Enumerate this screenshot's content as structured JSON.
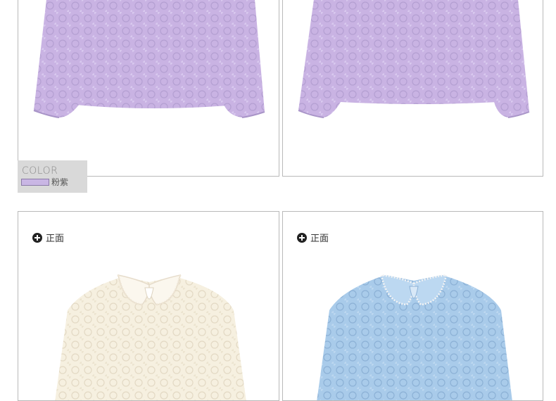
{
  "colors": {
    "lilac": "#c9b3e3",
    "lilac_shadow": "#a995c8",
    "cream": "#f6f0e0",
    "cream_shadow": "#e3d9c4",
    "blue": "#a9cbea",
    "blue_shadow": "#8cb1d6",
    "border": "#b9b9b9",
    "swatch_bg": "#d9d9d9"
  },
  "swatch": {
    "heading": "COLOR",
    "color_name": "粉紫",
    "chip_color": "#c9b6e4"
  },
  "panels": [
    {
      "view_label": "",
      "garment_color": "lilac"
    },
    {
      "view_label": "",
      "garment_color": "lilac"
    },
    {
      "view_label": "正面",
      "view_icon": "plus-circle-icon",
      "garment_color": "cream"
    },
    {
      "view_label": "正面",
      "view_icon": "plus-circle-icon",
      "garment_color": "blue"
    }
  ]
}
